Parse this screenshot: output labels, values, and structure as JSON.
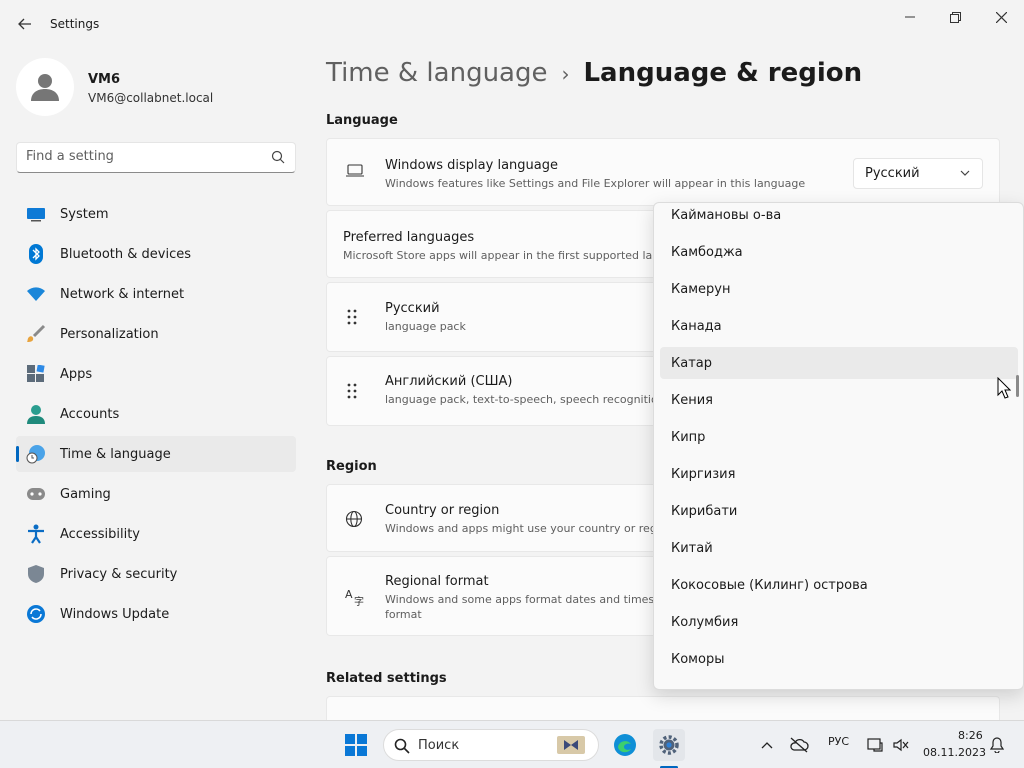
{
  "window": {
    "title": "Settings"
  },
  "user": {
    "name": "VM6",
    "email": "VM6@collabnet.local"
  },
  "search": {
    "placeholder": "Find a setting",
    "value": ""
  },
  "nav": {
    "items": [
      {
        "label": "System",
        "icon": "system-icon"
      },
      {
        "label": "Bluetooth & devices",
        "icon": "bluetooth-icon"
      },
      {
        "label": "Network & internet",
        "icon": "wifi-icon"
      },
      {
        "label": "Personalization",
        "icon": "brush-icon"
      },
      {
        "label": "Apps",
        "icon": "apps-icon"
      },
      {
        "label": "Accounts",
        "icon": "accounts-icon"
      },
      {
        "label": "Time & language",
        "icon": "time-language-icon",
        "active": true
      },
      {
        "label": "Gaming",
        "icon": "gamepad-icon"
      },
      {
        "label": "Accessibility",
        "icon": "accessibility-icon"
      },
      {
        "label": "Privacy & security",
        "icon": "shield-icon"
      },
      {
        "label": "Windows Update",
        "icon": "update-icon"
      }
    ]
  },
  "breadcrumb": {
    "parent": "Time & language",
    "separator": "›",
    "current": "Language & region"
  },
  "language": {
    "heading": "Language",
    "display": {
      "title": "Windows display language",
      "subtitle": "Windows features like Settings and File Explorer will appear in this language",
      "selected": "Русский"
    },
    "preferred": {
      "title": "Preferred languages",
      "subtitle": "Microsoft Store apps will appear in the first supported lang"
    },
    "languages": [
      {
        "title": "Русский",
        "subtitle": "language pack"
      },
      {
        "title": "Английский (США)",
        "subtitle": "language pack, text-to-speech, speech recognition,"
      }
    ]
  },
  "region": {
    "heading": "Region",
    "country": {
      "title": "Country or region",
      "subtitle": "Windows and apps might use your country or regio"
    },
    "format": {
      "title": "Regional format",
      "subtitle_line1": "Windows and some apps format dates and times b",
      "subtitle_line2": "format"
    }
  },
  "related": {
    "heading": "Related settings"
  },
  "dropdown": {
    "items": [
      "Каймановы о-ва",
      "Камбоджа",
      "Камерун",
      "Канада",
      "Катар",
      "Кения",
      "Кипр",
      "Киргизия",
      "Кирибати",
      "Китай",
      "Кокосовые (Килинг) острова",
      "Колумбия",
      "Коморы"
    ],
    "hovered_index": 4
  },
  "taskbar": {
    "search_label": "Поиск",
    "input_indicator": "РУС",
    "time": "8:26",
    "date": "08.11.2023"
  },
  "colors": {
    "accent": "#0067c0",
    "background": "#f3f3f3",
    "card": "#fbfbfb"
  }
}
